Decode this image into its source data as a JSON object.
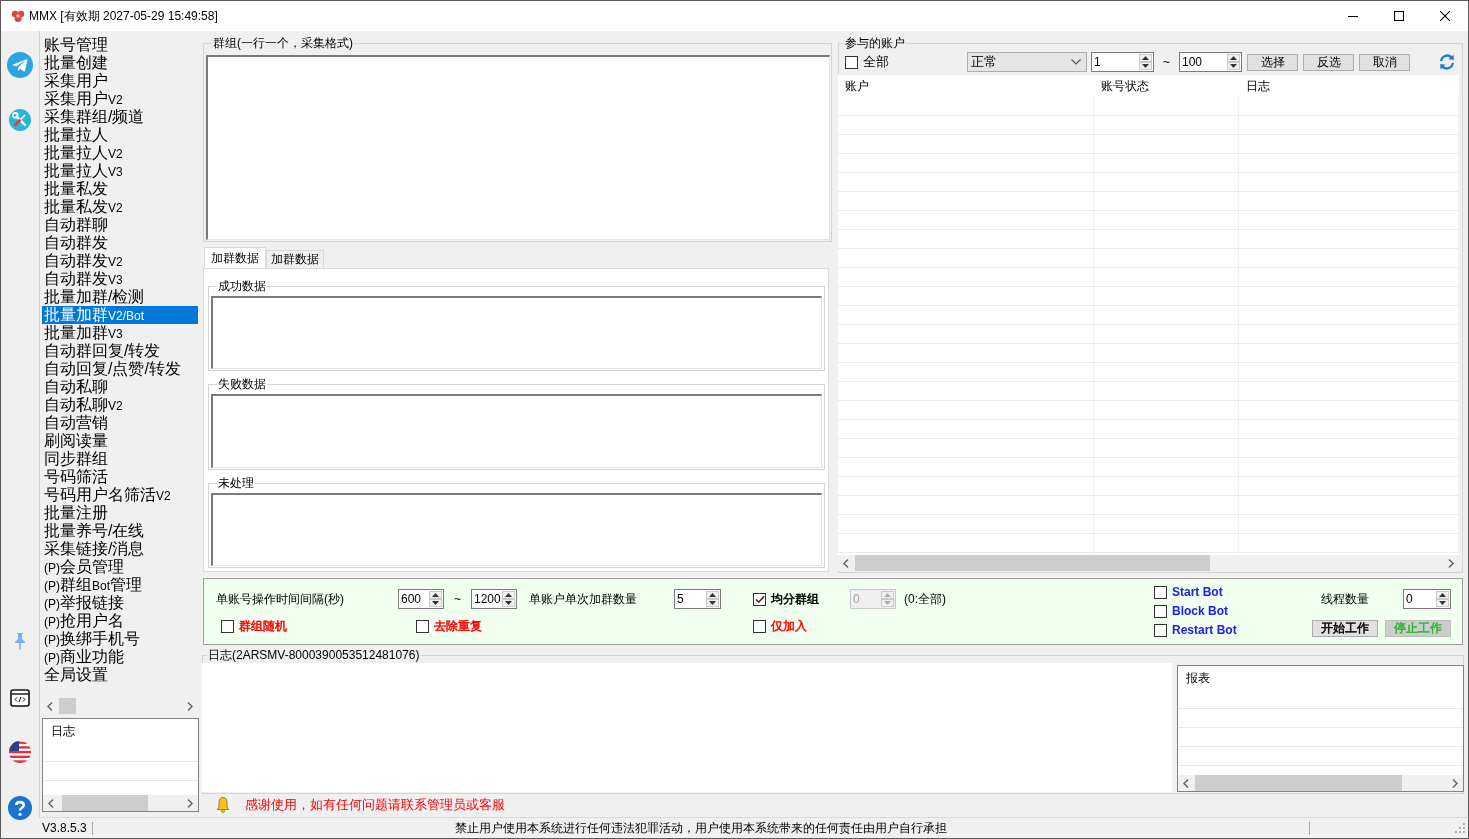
{
  "window": {
    "title": "MMX [有效期 2027-05-29 15:49:58]"
  },
  "menu": {
    "items": [
      {
        "label": "账号管理",
        "selected": false
      },
      {
        "label": "批量创建",
        "selected": false
      },
      {
        "label": "采集用户",
        "selected": false
      },
      {
        "label": "采集用户V2",
        "selected": false
      },
      {
        "label": "采集群组/频道",
        "selected": false
      },
      {
        "label": "批量拉人",
        "selected": false
      },
      {
        "label": "批量拉人V2",
        "selected": false
      },
      {
        "label": "批量拉人V3",
        "selected": false
      },
      {
        "label": "批量私发",
        "selected": false
      },
      {
        "label": "批量私发V2",
        "selected": false
      },
      {
        "label": "自动群聊",
        "selected": false
      },
      {
        "label": "自动群发",
        "selected": false
      },
      {
        "label": "自动群发V2",
        "selected": false
      },
      {
        "label": "自动群发V3",
        "selected": false
      },
      {
        "label": "批量加群/检测",
        "selected": false
      },
      {
        "label": "批量加群V2/Bot",
        "selected": true
      },
      {
        "label": "批量加群V3",
        "selected": false
      },
      {
        "label": "自动群回复/转发",
        "selected": false
      },
      {
        "label": "自动回复/点赞/转发",
        "selected": false
      },
      {
        "label": "自动私聊",
        "selected": false
      },
      {
        "label": "自动私聊V2",
        "selected": false
      },
      {
        "label": "自动营销",
        "selected": false
      },
      {
        "label": "刷阅读量",
        "selected": false
      },
      {
        "label": "同步群组",
        "selected": false
      },
      {
        "label": "号码筛活",
        "selected": false
      },
      {
        "label": "号码用户名筛活V2",
        "selected": false
      },
      {
        "label": "批量注册",
        "selected": false
      },
      {
        "label": "批量养号/在线",
        "selected": false
      },
      {
        "label": "采集链接/消息",
        "selected": false
      },
      {
        "label": "(P)会员管理",
        "selected": false
      },
      {
        "label": "(P)群组Bot管理",
        "selected": false
      },
      {
        "label": "(P)举报链接",
        "selected": false
      },
      {
        "label": "(P)抢用户名",
        "selected": false
      },
      {
        "label": "(P)换绑手机号",
        "selected": false
      },
      {
        "label": "(P)商业功能",
        "selected": false
      },
      {
        "label": "全局设置",
        "selected": false
      }
    ]
  },
  "menu_log": {
    "columns": [
      "日志"
    ]
  },
  "groups_input": {
    "title": "群组(一行一个，采集格式)"
  },
  "data_tabs": [
    {
      "label": "加群数据",
      "selected": true
    },
    {
      "label": "加群数据",
      "selected": false
    }
  ],
  "data_boxes": [
    {
      "title": "成功数据"
    },
    {
      "title": "失败数据"
    },
    {
      "title": "未处理"
    }
  ],
  "accounts": {
    "title": "参与的账户",
    "select_all": {
      "label": "全部",
      "checked": false
    },
    "status_filter": "正常",
    "range": {
      "from": "1",
      "separator": "~",
      "to": "100"
    },
    "buttons": [
      "选择",
      "反选",
      "取消"
    ],
    "table": {
      "columns": [
        "账户",
        "账号状态",
        "日志"
      ]
    }
  },
  "options": {
    "row_1": [
      {
        "kind": "label",
        "text": "单账号操作时间间隔(秒)"
      },
      {
        "kind": "spin",
        "value": "600",
        "disabled": false
      },
      {
        "kind": "label",
        "text": "~"
      },
      {
        "kind": "spin",
        "value": "1200",
        "disabled": false
      },
      {
        "kind": "label",
        "text": "单账户单次加群数量"
      },
      {
        "kind": "spin",
        "value": "5",
        "disabled": false
      },
      {
        "kind": "check",
        "label": "均分群组",
        "checked": true,
        "color": "#000000"
      },
      {
        "kind": "spin",
        "value": "0",
        "disabled": true
      },
      {
        "kind": "label",
        "text": "(0:全部)"
      }
    ],
    "row_2": [
      {
        "kind": "check",
        "label": "群组随机",
        "checked": false,
        "color": "#ff0000"
      },
      {
        "kind": "check",
        "label": "去除重复",
        "checked": false,
        "color": "#ff0000"
      },
      {
        "kind": "check",
        "label": "仅加入",
        "checked": false,
        "color": "#ff0000"
      }
    ],
    "bots": [
      {
        "label": "Start Bot",
        "checked": false
      },
      {
        "label": "Block Bot",
        "checked": false
      },
      {
        "label": "Restart Bot",
        "checked": false
      }
    ],
    "thread_count": {
      "label": "线程数量",
      "value": "0"
    },
    "actions": [
      {
        "label": "开始工作",
        "disabled": false,
        "color": "#000000"
      },
      {
        "label": "停止工作",
        "disabled": true,
        "color": "#2eb82e"
      }
    ]
  },
  "log": {
    "title": "日志(2ARSMV-8000390053512481076)",
    "report": {
      "columns": [
        "报表"
      ]
    }
  },
  "notice": "感谢使用，如有任何问题请联系管理员或客服",
  "status_bar": {
    "version": "V3.8.5.3",
    "message": "禁止用户使用本系统进行任何违法犯罪活动，用户使用本系统带来的任何责任由用户自行承担"
  }
}
